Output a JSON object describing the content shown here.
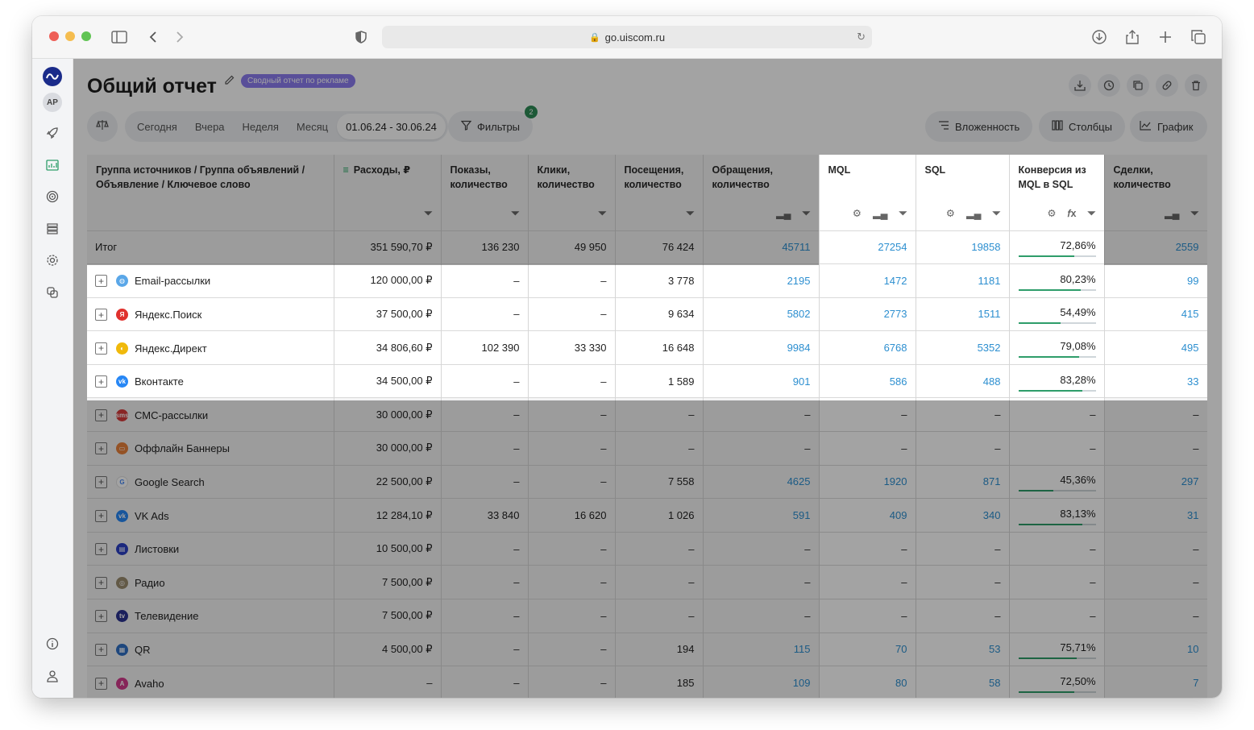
{
  "browser": {
    "url": "go.uiscom.ru"
  },
  "sidebar": {
    "avatar": "AP"
  },
  "header": {
    "title": "Общий отчет",
    "badge": "Сводный отчет по рекламе"
  },
  "toolbar": {
    "periods": [
      "Сегодня",
      "Вчера",
      "Неделя",
      "Месяц"
    ],
    "date_range": "01.06.24 - 30.06.24",
    "filters_label": "Фильтры",
    "filters_count": "2",
    "nesting_label": "Вложенность",
    "columns_label": "Столбцы",
    "chart_label": "График"
  },
  "table": {
    "columns": [
      "Группа источников / Группа объявлений / Объявление / Ключевое слово",
      "Расходы, ₽",
      "Показы, количество",
      "Клики, количество",
      "Посещения, количество",
      "Обращения, количество",
      "MQL",
      "SQL",
      "Конверсия из MQL в SQL",
      "Сделки, количество"
    ],
    "total": {
      "name": "Итог",
      "cost": "351 590,70 ₽",
      "impressions": "136 230",
      "clicks": "49 950",
      "visits": "76 424",
      "leads": "45711",
      "mql": "27254",
      "sql": "19858",
      "conversion": "72,86%",
      "conversion_value": 72.86,
      "deals": "2559"
    },
    "rows": [
      {
        "name": "Email-рассылки",
        "icon": "globe-icon",
        "color": "#5aa7e8",
        "cost": "120 000,00 ₽",
        "impressions": "–",
        "clicks": "–",
        "visits": "3 778",
        "leads": "2195",
        "mql": "1472",
        "sql": "1181",
        "conversion": "80,23%",
        "conversion_value": 80.23,
        "deals": "99"
      },
      {
        "name": "Яндекс.Поиск",
        "icon": "yandex-icon",
        "color": "#e0312d",
        "cost": "37 500,00 ₽",
        "impressions": "–",
        "clicks": "–",
        "visits": "9 634",
        "leads": "5802",
        "mql": "2773",
        "sql": "1511",
        "conversion": "54,49%",
        "conversion_value": 54.49,
        "deals": "415"
      },
      {
        "name": "Яндекс.Директ",
        "icon": "yandex-direct-icon",
        "color": "#f0b90b",
        "cost": "34 806,60 ₽",
        "impressions": "102 390",
        "clicks": "33 330",
        "visits": "16 648",
        "leads": "9984",
        "mql": "6768",
        "sql": "5352",
        "conversion": "79,08%",
        "conversion_value": 79.08,
        "deals": "495"
      },
      {
        "name": "Вконтакте",
        "icon": "vk-icon",
        "color": "#2787f5",
        "cost": "34 500,00 ₽",
        "impressions": "–",
        "clicks": "–",
        "visits": "1 589",
        "leads": "901",
        "mql": "586",
        "sql": "488",
        "conversion": "83,28%",
        "conversion_value": 83.28,
        "deals": "33"
      },
      {
        "name": "СМС-рассылки",
        "icon": "sms-icon",
        "color": "#d63a3a",
        "cost": "30 000,00 ₽",
        "impressions": "–",
        "clicks": "–",
        "visits": "–",
        "leads": "–",
        "mql": "–",
        "sql": "–",
        "conversion": "–",
        "conversion_value": null,
        "deals": "–"
      },
      {
        "name": "Оффлайн Баннеры",
        "icon": "banner-icon",
        "color": "#e8803a",
        "cost": "30 000,00 ₽",
        "impressions": "–",
        "clicks": "–",
        "visits": "–",
        "leads": "–",
        "mql": "–",
        "sql": "–",
        "conversion": "–",
        "conversion_value": null,
        "deals": "–"
      },
      {
        "name": "Google Search",
        "icon": "google-icon",
        "color": "#ffffff",
        "cost": "22 500,00 ₽",
        "impressions": "–",
        "clicks": "–",
        "visits": "7 558",
        "leads": "4625",
        "mql": "1920",
        "sql": "871",
        "conversion": "45,36%",
        "conversion_value": 45.36,
        "deals": "297"
      },
      {
        "name": "VK Ads",
        "icon": "vk-icon",
        "color": "#2787f5",
        "cost": "12 284,10 ₽",
        "impressions": "33 840",
        "clicks": "16 620",
        "visits": "1 026",
        "leads": "591",
        "mql": "409",
        "sql": "340",
        "conversion": "83,13%",
        "conversion_value": 83.13,
        "deals": "31"
      },
      {
        "name": "Листовки",
        "icon": "leaflet-icon",
        "color": "#2b3fc4",
        "cost": "10 500,00 ₽",
        "impressions": "–",
        "clicks": "–",
        "visits": "–",
        "leads": "–",
        "mql": "–",
        "sql": "–",
        "conversion": "–",
        "conversion_value": null,
        "deals": "–"
      },
      {
        "name": "Радио",
        "icon": "radio-icon",
        "color": "#9a8c6e",
        "cost": "7 500,00 ₽",
        "impressions": "–",
        "clicks": "–",
        "visits": "–",
        "leads": "–",
        "mql": "–",
        "sql": "–",
        "conversion": "–",
        "conversion_value": null,
        "deals": "–"
      },
      {
        "name": "Телевидение",
        "icon": "tv-icon",
        "color": "#2b3290",
        "cost": "7 500,00 ₽",
        "impressions": "–",
        "clicks": "–",
        "visits": "–",
        "leads": "–",
        "mql": "–",
        "sql": "–",
        "conversion": "–",
        "conversion_value": null,
        "deals": "–"
      },
      {
        "name": "QR",
        "icon": "qr-icon",
        "color": "#2f6fc4",
        "cost": "4 500,00 ₽",
        "impressions": "–",
        "clicks": "–",
        "visits": "194",
        "leads": "115",
        "mql": "70",
        "sql": "53",
        "conversion": "75,71%",
        "conversion_value": 75.71,
        "deals": "10"
      },
      {
        "name": "Avaho",
        "icon": "avaho-icon",
        "color": "#d23a8c",
        "cost": "–",
        "impressions": "–",
        "clicks": "–",
        "visits": "185",
        "leads": "109",
        "mql": "80",
        "sql": "58",
        "conversion": "72,50%",
        "conversion_value": 72.5,
        "deals": "7"
      }
    ]
  },
  "colors": {
    "accent_link": "#2d8fd0",
    "progress": "#2e9d6a",
    "badge": "#8b7cf0",
    "filter_count": "#2e8b57"
  }
}
